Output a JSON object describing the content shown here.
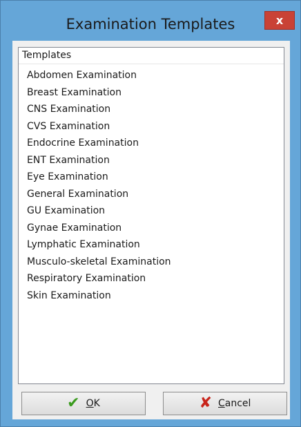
{
  "window": {
    "title": "Examination Templates",
    "close_label": "x"
  },
  "list": {
    "header": "Templates",
    "items": [
      "Abdomen Examination",
      "Breast Examination",
      "CNS Examination",
      "CVS Examination",
      "Endocrine Examination",
      "ENT Examination",
      "Eye Examination",
      "General Examination",
      "GU Examination",
      "Gynae Examination",
      "Lymphatic Examination",
      "Musculo-skeletal Examination",
      "Respiratory Examination",
      "Skin Examination"
    ]
  },
  "buttons": {
    "ok": {
      "mnemonic": "O",
      "rest": "K",
      "icon": "checkmark-icon"
    },
    "cancel": {
      "mnemonic": "C",
      "rest": "ancel",
      "icon": "cross-icon"
    }
  },
  "colors": {
    "titlebar": "#65a6d8",
    "close_button": "#c94236",
    "ok_icon": "#3a9b1e",
    "cancel_icon": "#c8241b"
  }
}
